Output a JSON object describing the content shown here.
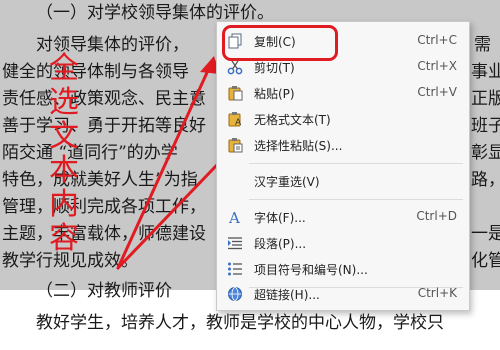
{
  "document": {
    "lines": [
      "（一）对学校领导集体的评价。",
      "对领导集体的评价，",
      "健全的领导体制与各领导",
      "责任感、政策观念、民主意",
      "善于学习、勇于开拓等良好",
      "陌交通  “道同行”的办学",
      "特色，成就美好人生”为指",
      "管理，顺利完成各项工作，",
      "主题，丰富载体，师德建设",
      "教学行规见成效。",
      "（二）对教师评价",
      "教好学生，培养人才，教师是学校的中心人物，学校只"
    ],
    "right_fragments": [
      "需",
      "事业",
      "正版",
      "班子",
      "彰显",
      "路，",
      "一是",
      "化管"
    ]
  },
  "annotation": {
    "chars": [
      "全",
      "选",
      "文",
      "本",
      "内",
      "容"
    ],
    "color": "#e01b22"
  },
  "context_menu": {
    "items": [
      {
        "label": "复制(C)",
        "shortcut": "Ctrl+C",
        "icon": "copy-icon"
      },
      {
        "label": "剪切(T)",
        "shortcut": "Ctrl+X",
        "icon": "scissors-icon"
      },
      {
        "label": "粘贴(P)",
        "shortcut": "Ctrl+V",
        "icon": "paste-icon"
      },
      {
        "label": "无格式文本(T)",
        "shortcut": "",
        "icon": "paste-text-icon"
      },
      {
        "label": "选择性粘贴(S)...",
        "shortcut": "",
        "icon": "paste-special-icon"
      },
      {
        "label": "汉字重选(V)",
        "shortcut": "",
        "icon": ""
      },
      {
        "label": "字体(F)...",
        "shortcut": "Ctrl+D",
        "icon": "font-icon"
      },
      {
        "label": "段落(P)...",
        "shortcut": "",
        "icon": "paragraph-icon"
      },
      {
        "label": "项目符号和编号(N)...",
        "shortcut": "",
        "icon": "bullets-icon"
      },
      {
        "label": "超链接(H)...",
        "shortcut": "Ctrl+K",
        "icon": "hyperlink-icon"
      }
    ]
  },
  "colors": {
    "accent": "#e01b22",
    "selection": "#c8c8c8",
    "menu_bg": "#f7f7f7"
  }
}
